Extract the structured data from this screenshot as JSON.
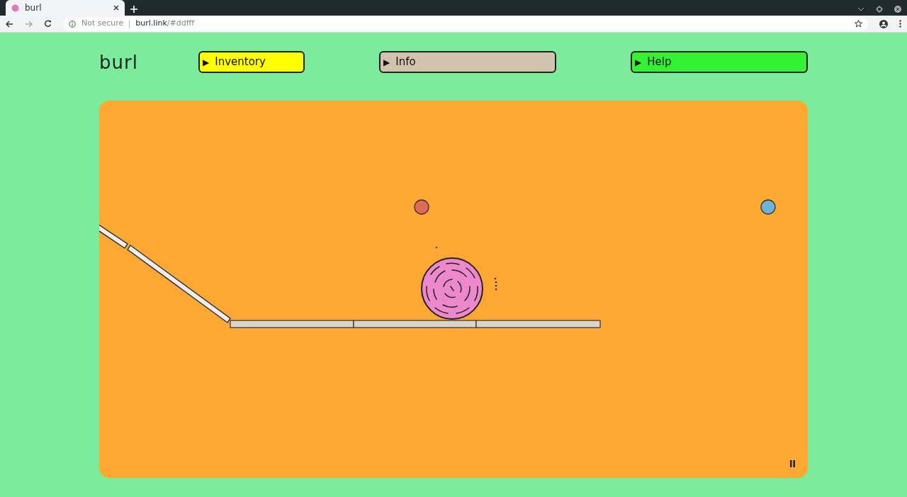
{
  "browser": {
    "tab_title": "burl",
    "security": "Not secure",
    "url_host": "burl.link",
    "url_rest": "/#ddfff"
  },
  "logo": "burl",
  "menu": [
    {
      "arrow": "▶",
      "label": "Inventory",
      "color": "#ffff00"
    },
    {
      "arrow": "▶",
      "label": "Info",
      "color": "#d2c3af"
    },
    {
      "arrow": "▶",
      "label": "Help",
      "color": "#33f233"
    }
  ]
}
